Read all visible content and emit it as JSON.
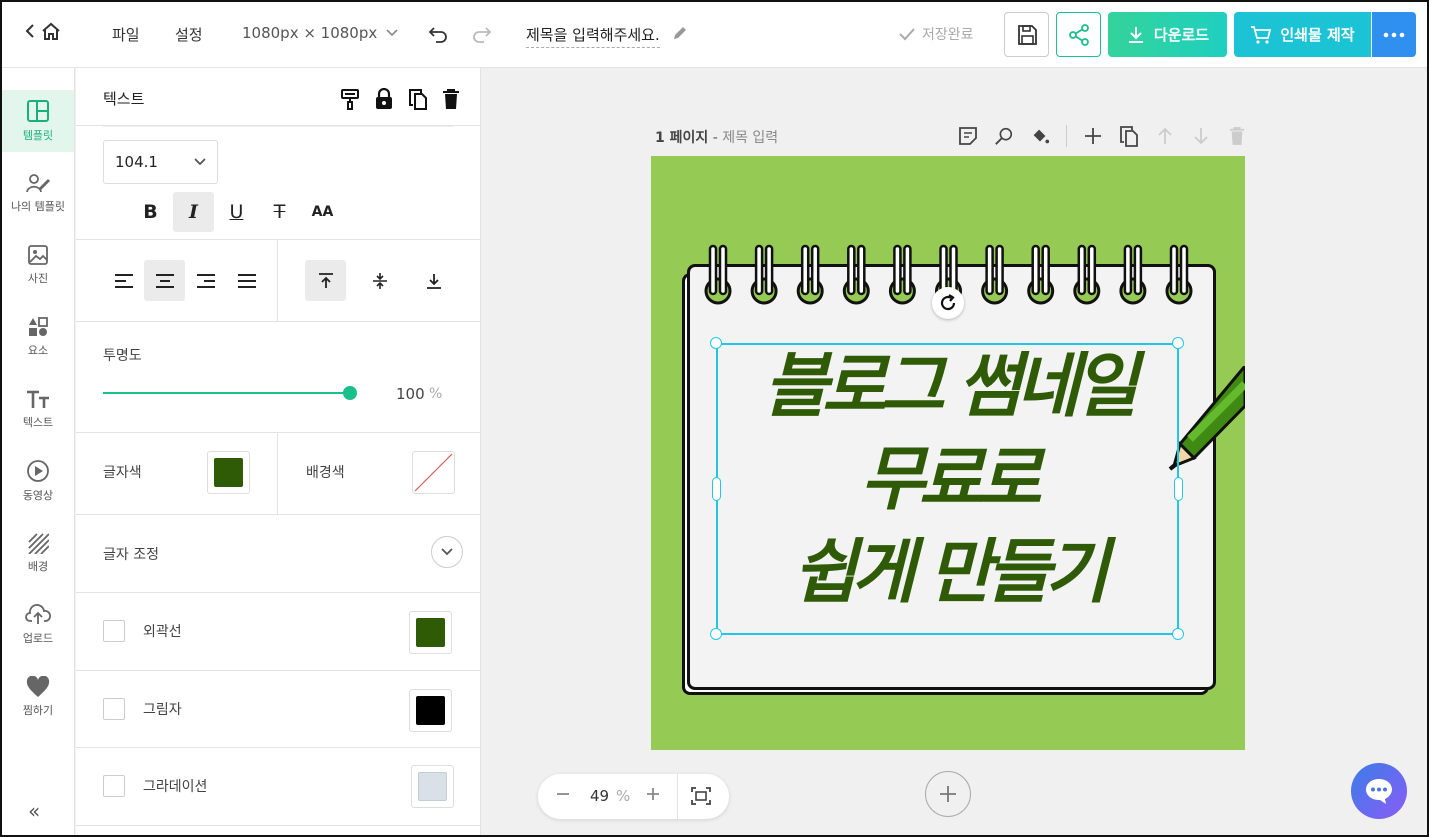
{
  "topbar": {
    "menu_file": "파일",
    "menu_settings": "설정",
    "canvas_size": "1080px × 1080px",
    "doc_title": "제목을 입력해주세요.",
    "save_status": "저장완료",
    "download_label": "다운로드",
    "print_label": "인쇄물 제작"
  },
  "rail": {
    "items": [
      {
        "label": "템플릿",
        "icon": "template-icon"
      },
      {
        "label": "나의 템플릿",
        "icon": "my-template-icon"
      },
      {
        "label": "사진",
        "icon": "photo-icon"
      },
      {
        "label": "요소",
        "icon": "elements-icon"
      },
      {
        "label": "텍스트",
        "icon": "text-icon"
      },
      {
        "label": "동영상",
        "icon": "video-icon"
      },
      {
        "label": "배경",
        "icon": "background-icon"
      },
      {
        "label": "업로드",
        "icon": "upload-icon"
      },
      {
        "label": "찜하기",
        "icon": "heart-icon"
      }
    ],
    "collapse_label": "«"
  },
  "panel": {
    "title": "텍스트",
    "font_size": "104.1",
    "style_buttons": {
      "bold": "B",
      "italic": "I",
      "underline": "U",
      "strike": "T",
      "case": "AA"
    },
    "opacity_label": "투명도",
    "opacity_value": "100",
    "opacity_unit": "%",
    "text_color_label": "글자색",
    "bg_color_label": "배경색",
    "text_adjust_label": "글자 조정",
    "outline_label": "외곽선",
    "shadow_label": "그림자",
    "gradient_label": "그라데이션",
    "colors": {
      "text": "#2f5a06",
      "outline": "#2f5a06",
      "shadow": "#000000",
      "gradient": "#d9e0e8"
    }
  },
  "canvas": {
    "page_number": "1 페이지",
    "page_separator": " - ",
    "page_title_placeholder": "제목 입력",
    "headline_line1": "블로그 썸네일",
    "headline_line2": "무료로",
    "headline_line3": "쉽게 만들기",
    "design_bg": "#95cb54",
    "zoom_value": "49",
    "zoom_unit": "%"
  }
}
